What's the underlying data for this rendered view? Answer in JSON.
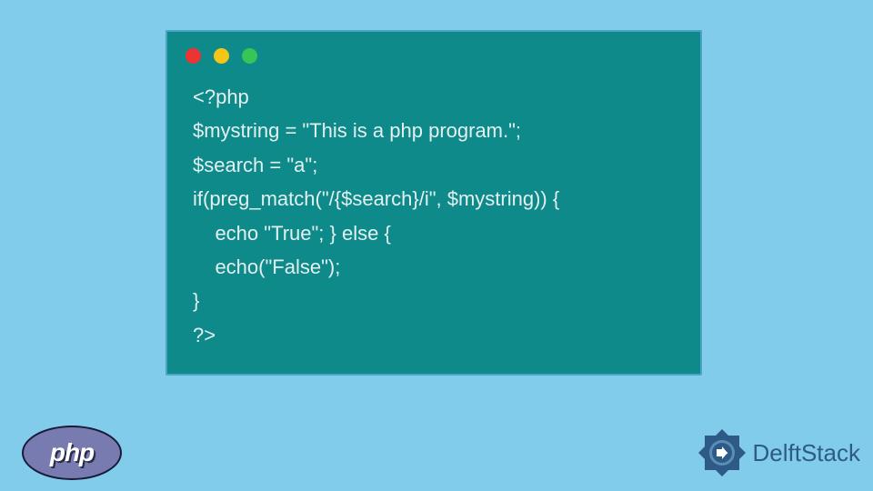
{
  "code": {
    "line1": "<?php",
    "line2": "$mystring = \"This is a php program.\";",
    "line3": "$search = \"a\";",
    "line4": "if(preg_match(\"/{$search}/i\", $mystring)) {",
    "line5": "    echo \"True\"; } else {",
    "line6": "    echo(\"False\");",
    "line7": "}",
    "line8": "?>"
  },
  "php_badge": {
    "label": "php"
  },
  "delft": {
    "label": "DelftStack"
  }
}
